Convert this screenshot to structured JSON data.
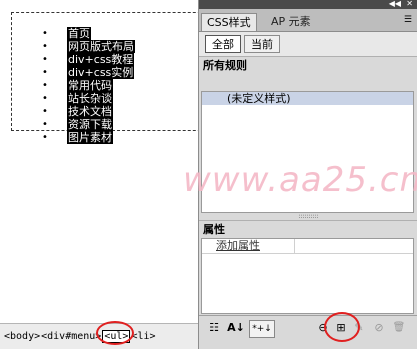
{
  "canvas": {
    "menu_items": [
      "首页",
      "网页版式布局",
      "div+css教程",
      "div+css实例",
      "常用代码",
      "站长杂谈",
      "技术文档",
      "资源下载",
      "图片素材"
    ],
    "bullet": "•"
  },
  "watermark": "www.aa25.cn",
  "tag_selector": {
    "tags": [
      "<body>",
      "<div#menu>",
      "<ul>",
      "<li>"
    ],
    "selected_index": 2
  },
  "panel": {
    "collapse_icon": "◀◀",
    "menu_icon": "✕",
    "tabs": [
      "CSS样式",
      "AP 元素"
    ],
    "tab_menu_icon": "☰",
    "segments": [
      "全部",
      "当前"
    ],
    "all_rules_label": "所有规则",
    "rules": [
      "(未定义样式)"
    ],
    "splitter_glyph": "::::::::::",
    "properties_label": "属性",
    "add_property_link": "添加属性",
    "toolbar": {
      "category_view_icon": "☷",
      "alpha_view_icon": "A↓",
      "set_props_icon": "*+↓",
      "attach_stylesheet_icon": "⊖",
      "new_rule_icon": "⊞",
      "edit_rule_icon": "✎",
      "disable_icon": "⊘",
      "delete_icon": "🗑"
    }
  },
  "colors": {
    "highlight_circle": "#e02020",
    "selected_rule_bg": "#c9d3e6",
    "watermark": "#f4b9c7"
  }
}
